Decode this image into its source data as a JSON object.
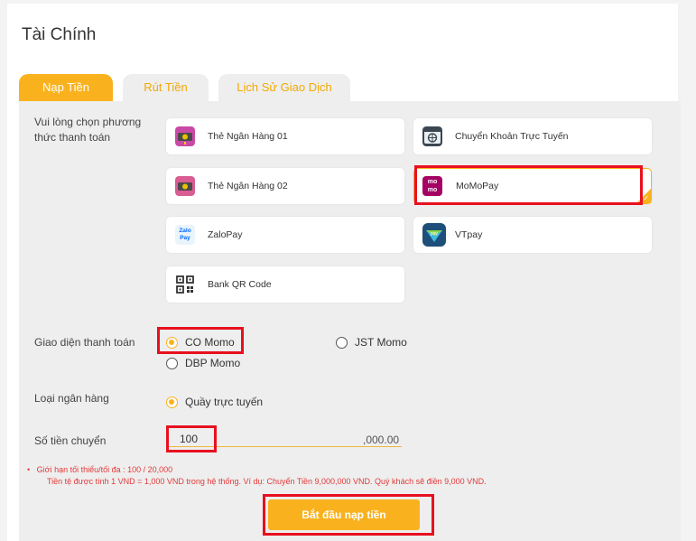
{
  "page": {
    "title": "Tài Chính"
  },
  "tabs": [
    {
      "label": "Nạp Tiền",
      "active": true
    },
    {
      "label": "Rút Tiền",
      "active": false
    },
    {
      "label": "Lịch Sử Giao Dịch",
      "active": false
    }
  ],
  "payment": {
    "label": "Vui lòng chọn phương thức thanh toán",
    "methods": [
      {
        "label": "Thẻ Ngân Hàng 01",
        "icon": "bank-card-icon"
      },
      {
        "label": "Chuyển Khoản Trực Tuyến",
        "icon": "online-transfer-icon"
      },
      {
        "label": "Thẻ Ngân Hàng 02",
        "icon": "bank-card-icon"
      },
      {
        "label": "MoMoPay",
        "icon": "momo-logo-icon",
        "selected": true
      },
      {
        "label": "ZaloPay",
        "icon": "zalopay-logo-icon"
      },
      {
        "label": "VTpay",
        "icon": "vtpay-logo-icon"
      },
      {
        "label": "Bank QR Code",
        "icon": "qr-code-icon"
      }
    ],
    "momo_logo_text": "mo mo",
    "zalopay_logo_text": "Zalo Pay",
    "vtpay_logo_text": "pay"
  },
  "interface": {
    "label": "Giao diện thanh toán",
    "options": [
      {
        "label": "CO Momo",
        "checked": true
      },
      {
        "label": "JST Momo",
        "checked": false
      },
      {
        "label": "DBP Momo",
        "checked": false
      }
    ]
  },
  "bank_type": {
    "label": "Loại ngân hàng",
    "option": "Quầy trực tuyến",
    "checked": true
  },
  "amount": {
    "label": "Số tiền chuyển",
    "value": "100",
    "suffix": ",000.00"
  },
  "notes": {
    "bullet": "•",
    "limit": "Giới hạn tối thiểu/tối đa : 100 / 20,000",
    "currency": "Tiền tệ được tính 1 VND = 1,000 VND trong hệ thống. Ví dụ: Chuyển Tiền 9,000,000 VND. Quý khách sẽ điền 9,000 VND."
  },
  "submit": {
    "label": "Bắt đầu nạp tiền"
  },
  "colors": {
    "accent": "#f9b21e",
    "highlight": "#e8101e",
    "note": "#e23a3a",
    "momo": "#a50064"
  }
}
